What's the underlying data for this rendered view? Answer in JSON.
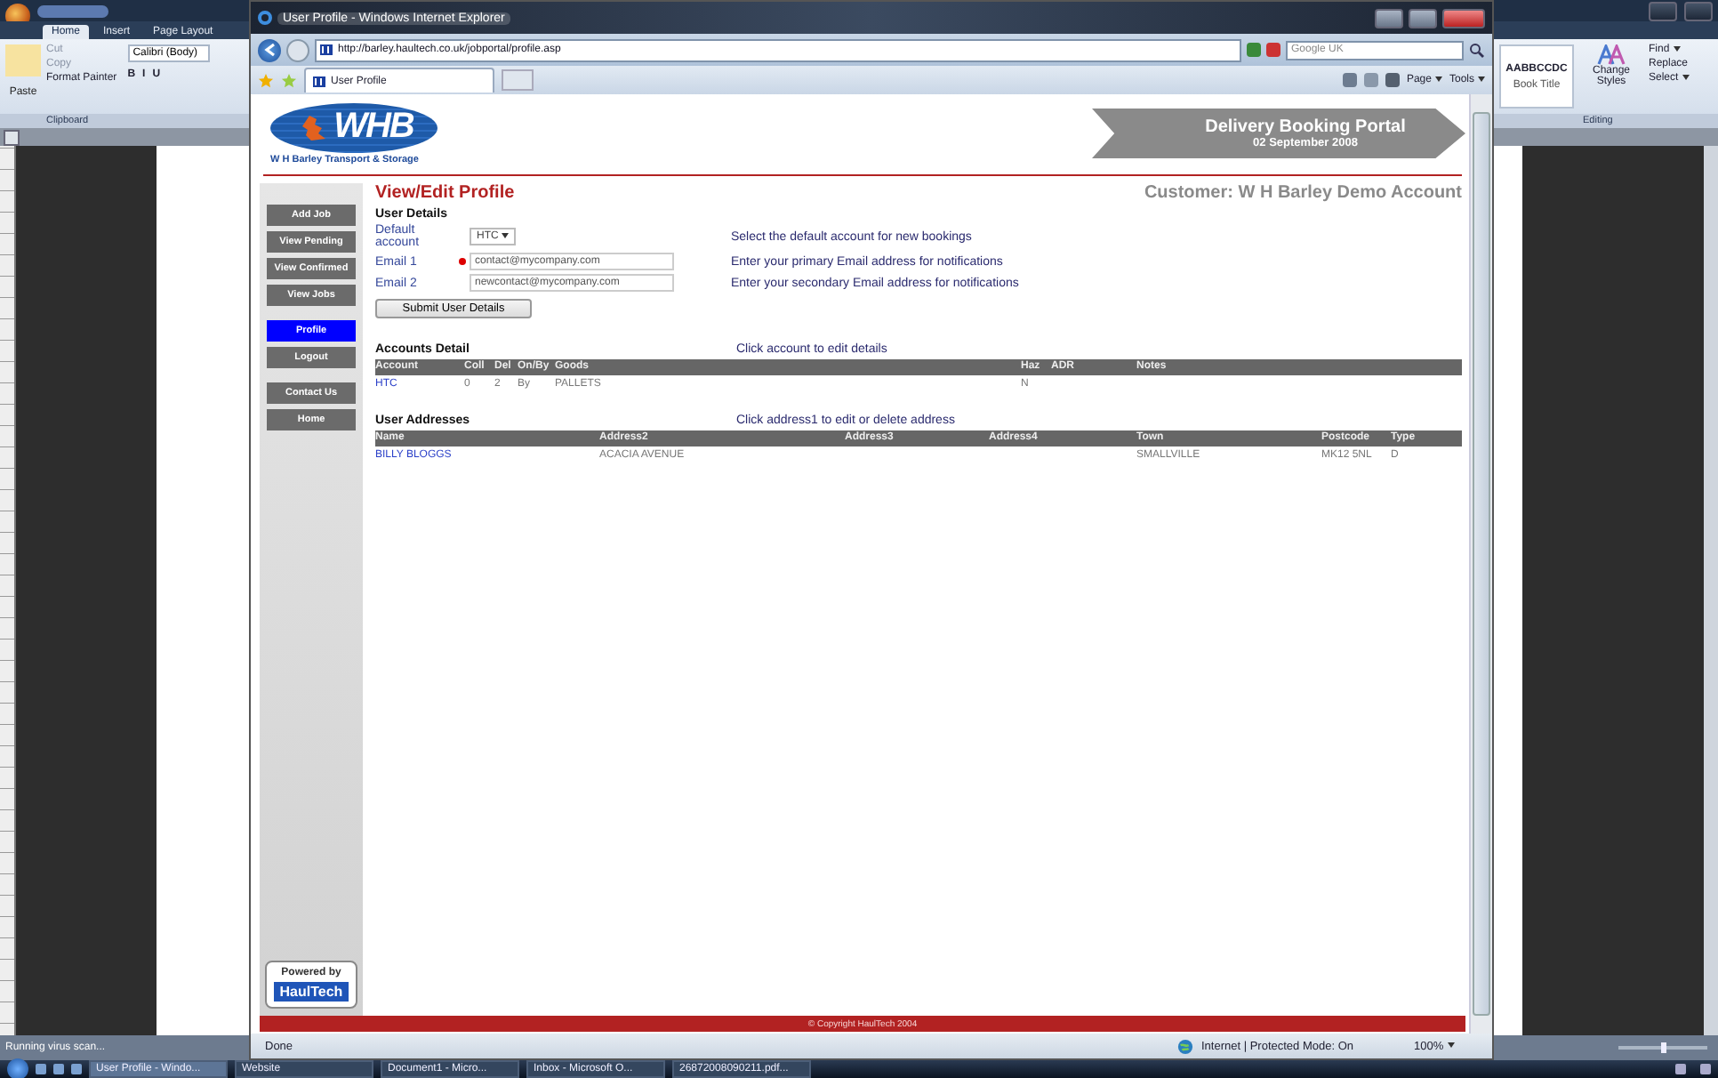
{
  "word": {
    "tabs": [
      {
        "label": "Home",
        "selected": true
      },
      {
        "label": "Insert",
        "selected": false
      },
      {
        "label": "Page Layout",
        "selected": false
      }
    ],
    "clipboard": {
      "paste": "Paste",
      "cut": "Cut",
      "copy": "Copy",
      "format_painter": "Format Painter",
      "group": "Clipboard"
    },
    "font": {
      "name": "Calibri (Body)",
      "buttons": [
        "B",
        "I",
        "U"
      ]
    },
    "styles": {
      "sample": "AABBCCDC",
      "name": "Book Title",
      "change": "Change Styles"
    },
    "editing": {
      "find": "Find",
      "replace": "Replace",
      "select": "Select",
      "group": "Editing"
    },
    "zoom_slider": {
      "level": 0.5
    },
    "status": "Running virus scan..."
  },
  "browser": {
    "title": "User Profile - Windows Internet Explorer",
    "address": "http://barley.haultech.co.uk/jobportal/profile.asp",
    "search": {
      "placeholder": "Google UK"
    },
    "tabs": [
      {
        "label": "User Profile",
        "selected": true
      }
    ],
    "commands": [
      "Page",
      "Tools"
    ],
    "status": {
      "text": "Done",
      "zone": "Internet | Protected Mode: On",
      "zoom": "100%"
    }
  },
  "page": {
    "logo": {
      "text": "WHB",
      "subtitle": "W H Barley Transport & Storage"
    },
    "banner": {
      "title": "Delivery Booking Portal",
      "date": "02 September 2008"
    },
    "heading": "View/Edit Profile",
    "customer": "Customer: W H Barley Demo Account",
    "nav": [
      {
        "label": "Add Job",
        "selected": false
      },
      {
        "label": "View Pending",
        "selected": false
      },
      {
        "label": "View Confirmed",
        "selected": false
      },
      {
        "label": "View Jobs",
        "selected": false
      },
      {
        "label": "Profile",
        "selected": true
      },
      {
        "label": "Logout",
        "selected": false
      },
      {
        "label": "Contact Us",
        "selected": false
      },
      {
        "label": "Home",
        "selected": false
      }
    ],
    "powered_by": {
      "label": "Powered by",
      "brand": "HaulTech"
    },
    "user_details": {
      "title": "User Details",
      "fields": [
        {
          "label": "Default account",
          "kind": "select",
          "value": "HTC",
          "required": false,
          "hint": "Select the default account for new bookings"
        },
        {
          "label": "Email 1",
          "kind": "input",
          "value": "contact@mycompany.com",
          "required": true,
          "hint": "Enter your primary Email address for notifications"
        },
        {
          "label": "Email 2",
          "kind": "input",
          "value": "newcontact@mycompany.com",
          "required": false,
          "hint": "Enter your secondary Email address for notifications"
        }
      ],
      "submit": "Submit User Details"
    },
    "accounts": {
      "title": "Accounts Detail",
      "hint": "Click account to edit details",
      "columns": [
        "Account",
        "Coll",
        "Del",
        "On/By",
        "Goods",
        "Haz",
        "ADR",
        "Notes"
      ],
      "rows": [
        [
          "HTC",
          "0",
          "2",
          "By",
          "PALLETS",
          "N",
          null,
          null
        ]
      ]
    },
    "addresses": {
      "title": "User Addresses",
      "hint": "Click address1 to edit or delete address",
      "columns": [
        "Name",
        "Address2",
        "Address3",
        "Address4",
        "Town",
        "Postcode",
        "Type"
      ],
      "rows": [
        [
          "BILLY BLOGGS",
          "ACACIA AVENUE",
          null,
          null,
          "SMALLVILLE",
          "MK12 5NL",
          "D"
        ]
      ]
    },
    "footer": "© Copyright  HaulTech 2004"
  },
  "taskbar": {
    "items": [
      {
        "label": "User Profile - Windo...",
        "selected": true
      },
      {
        "label": "Website",
        "selected": false
      },
      {
        "label": "Document1 - Micro...",
        "selected": false
      },
      {
        "label": "Inbox - Microsoft O...",
        "selected": false
      },
      {
        "label": "26872008090211.pdf...",
        "selected": false
      }
    ]
  }
}
